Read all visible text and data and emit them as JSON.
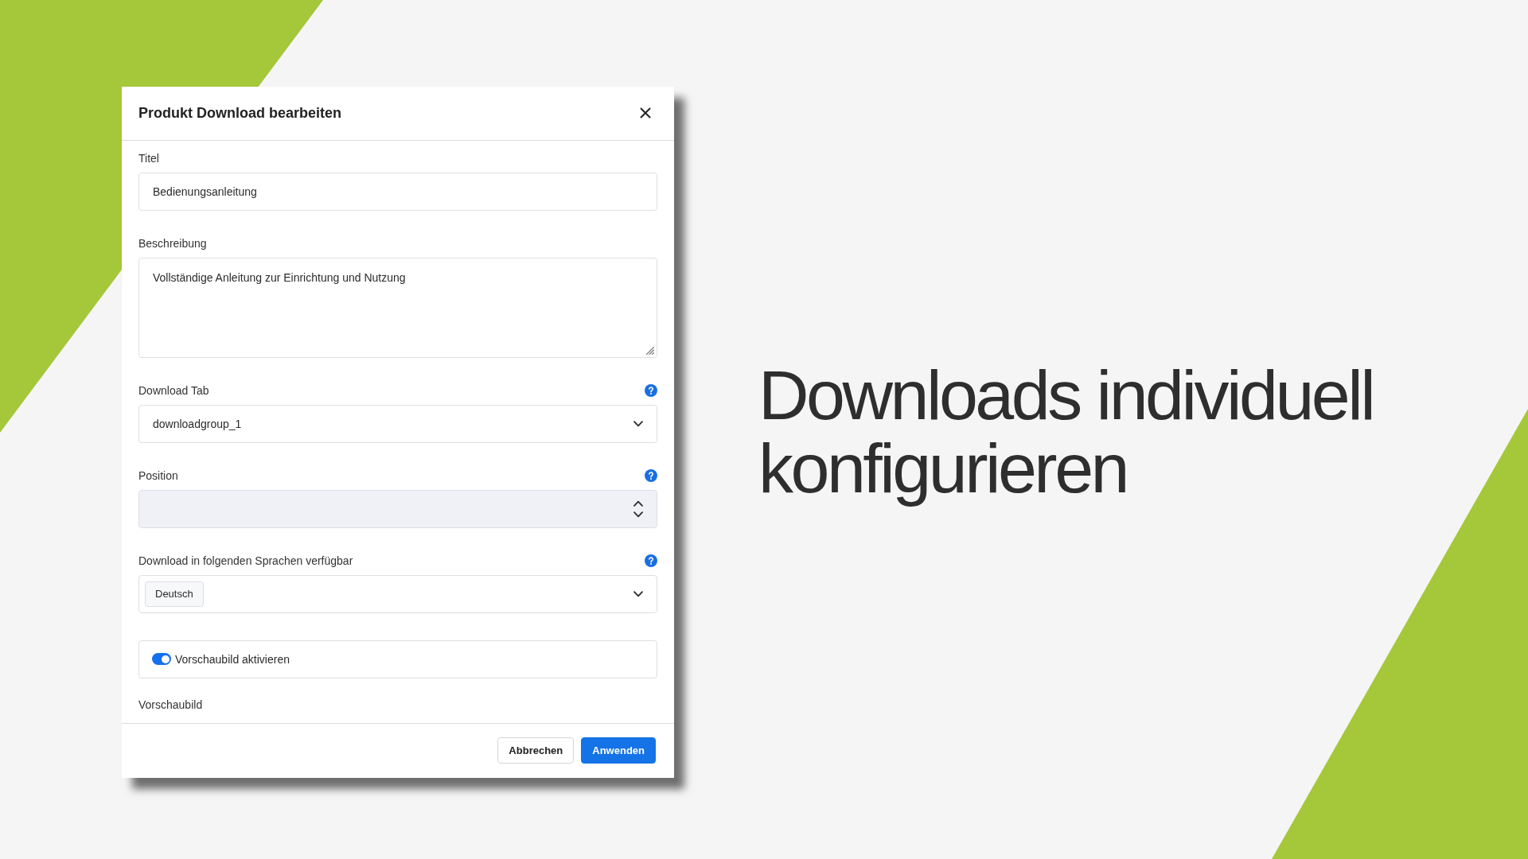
{
  "dialog": {
    "title": "Produkt Download bearbeiten",
    "fields": [
      {
        "kind": "text",
        "label": "Titel",
        "value": "Bedienungsanleitung",
        "help": false,
        "disabled": false
      },
      {
        "kind": "textarea",
        "label": "Beschreibung",
        "value": "Vollständige Anleitung zur Einrichtung und Nutzung",
        "help": false,
        "disabled": false
      },
      {
        "kind": "select",
        "label": "Download Tab",
        "value": "downloadgroup_1",
        "help": true,
        "disabled": false
      },
      {
        "kind": "number",
        "label": "Position",
        "help": true,
        "disabled": true
      },
      {
        "kind": "multiselect",
        "label": "Download in folgenden Sprachen verfügbar",
        "tags": [
          "Deutsch"
        ],
        "help": true,
        "disabled": false
      }
    ],
    "preview_toggle": {
      "label": "Vorschaubild aktivieren",
      "on": true
    },
    "preview_section": {
      "label": "Vorschaubild"
    },
    "buttons": [
      {
        "label": "Abbrechen",
        "kind": "secondary"
      },
      {
        "label": "Anwenden",
        "kind": "primary"
      }
    ]
  },
  "headline": "Downloads individuell konfigurieren"
}
